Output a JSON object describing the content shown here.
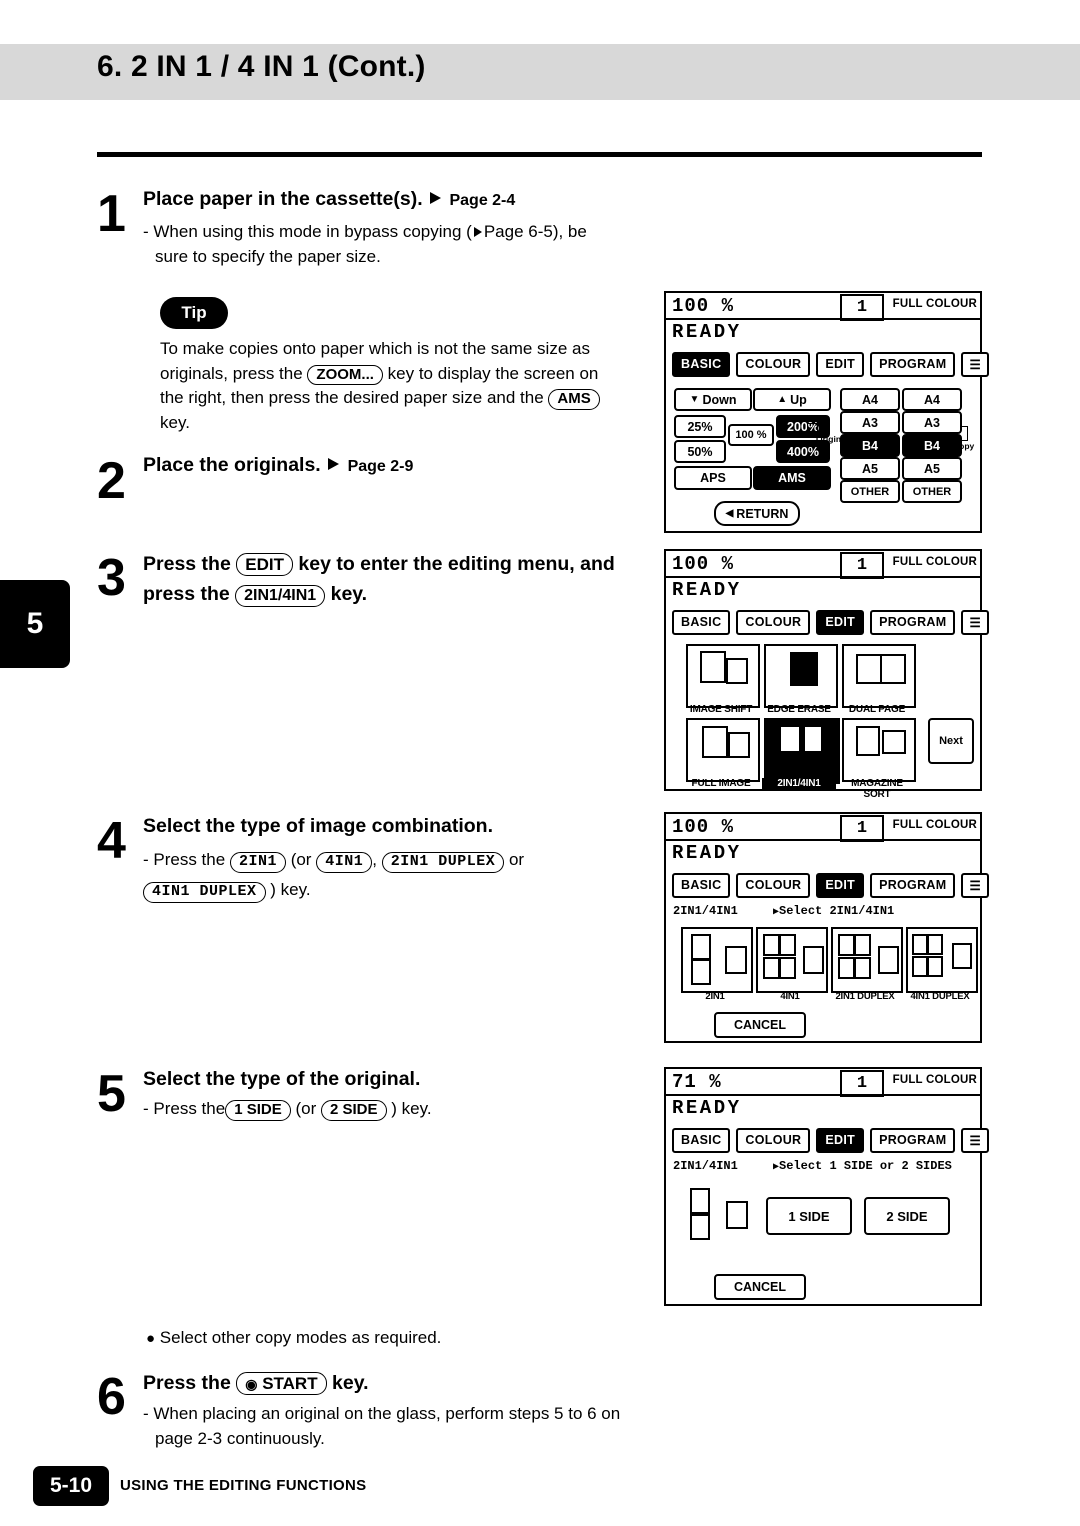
{
  "header": {
    "title": "6. 2 IN 1 / 4 IN 1 (Cont.)"
  },
  "side_tab": {
    "label": "5"
  },
  "footer": {
    "page": "5-10",
    "text": "USING THE EDITING FUNCTIONS"
  },
  "steps": [
    {
      "num": "1",
      "head": "Place paper in the cassette(s).",
      "head_ref": "Page 2-4",
      "body_a": "- When using this mode in bypass copying (",
      "body_b": "Page 6-5), be",
      "body_c": "sure to specify the paper size."
    },
    {
      "num": "2",
      "head": "Place the originals.",
      "head_ref": "Page 2-9"
    },
    {
      "num": "3",
      "head_a": "Press the",
      "key1": "EDIT",
      "head_b": "key to enter the editing menu, and",
      "head_c": "press the",
      "key2": "2IN1/4IN1",
      "head_d": "key."
    },
    {
      "num": "4",
      "head": "Select the type of image combination.",
      "body_a": "- Press the",
      "key1": "2IN1",
      "body_b": "(or",
      "key2": "4IN1",
      "body_c": ",",
      "key3": "2IN1 DUPLEX",
      "body_d": "or",
      "key4": "4IN1 DUPLEX",
      "body_e": ") key."
    },
    {
      "num": "5",
      "head": "Select the type of the original.",
      "body_a": "- Press the",
      "key1": "1 SIDE",
      "body_b": "(or",
      "key2": "2 SIDE",
      "body_c": ") key."
    },
    {
      "num": "6",
      "head_a": "Press the",
      "key1": "START",
      "head_b": "key.",
      "body_a": "- When placing an original on the glass, perform steps 5 to 6 on",
      "body_b": "page 2-3 continuously."
    }
  ],
  "tip": {
    "badge": "Tip",
    "line1": "To make copies onto paper which is not the same size as",
    "line2_a": "originals, press the",
    "key_zoom": "ZOOM...",
    "line2_b": "key to display the screen on",
    "line3_a": "the right, then press the desired paper size and the",
    "key_ams": "AMS",
    "line4": "key."
  },
  "note_bullet": "Select other copy modes as required.",
  "panels": {
    "zoom_panel": {
      "ratio": "100 %",
      "copies": "1",
      "full_colour": "FULL COLOUR",
      "ready": "READY",
      "tabs": [
        "BASIC",
        "COLOUR",
        "EDIT",
        "PROGRAM"
      ],
      "tab_icon": "list-icon",
      "selected_tab": "BASIC",
      "down": "Down",
      "up": "Up",
      "zoom_steps": [
        "25%",
        "200%",
        "50%",
        "400%"
      ],
      "center_ratio": "100 %",
      "original_label": "Original",
      "copy_label": "Copy",
      "aps": "APS",
      "ams": "AMS",
      "sizes_left": [
        "A4",
        "A3",
        "B4",
        "A5",
        "OTHER"
      ],
      "sizes_right": [
        "A4",
        "A3",
        "B4",
        "A5",
        "OTHER"
      ],
      "selected_size_left": "B4",
      "selected_size_right": "B4",
      "return": "RETURN"
    },
    "edit_panel": {
      "ratio": "100 %",
      "copies": "1",
      "full_colour": "FULL COLOUR",
      "ready": "READY",
      "tabs": [
        "BASIC",
        "COLOUR",
        "EDIT",
        "PROGRAM"
      ],
      "selected_tab": "EDIT",
      "items": [
        "IMAGE SHIFT",
        "EDGE ERASE",
        "DUAL PAGE",
        "FULL IMAGE",
        "2IN1/4IN1",
        "MAGAZINE SORT"
      ],
      "selected_item": "2IN1/4IN1",
      "next": "Next"
    },
    "combination_panel": {
      "ratio": "100 %",
      "copies": "1",
      "full_colour": "FULL COLOUR",
      "ready": "READY",
      "tabs": [
        "BASIC",
        "COLOUR",
        "EDIT",
        "PROGRAM"
      ],
      "selected_tab": "EDIT",
      "status_left": "2IN1/4IN1",
      "status_right": "Select 2IN1/4IN1",
      "options": [
        "2IN1",
        "4IN1",
        "2IN1 DUPLEX",
        "4IN1 DUPLEX"
      ],
      "cancel": "CANCEL"
    },
    "side_panel": {
      "ratio": "71 %",
      "copies": "1",
      "full_colour": "FULL COLOUR",
      "ready": "READY",
      "tabs": [
        "BASIC",
        "COLOUR",
        "EDIT",
        "PROGRAM"
      ],
      "selected_tab": "EDIT",
      "status_left": "2IN1/4IN1",
      "status_right": "Select 1 SIDE or 2 SIDES",
      "options": [
        "1 SIDE",
        "2 SIDE"
      ],
      "cancel": "CANCEL"
    }
  }
}
